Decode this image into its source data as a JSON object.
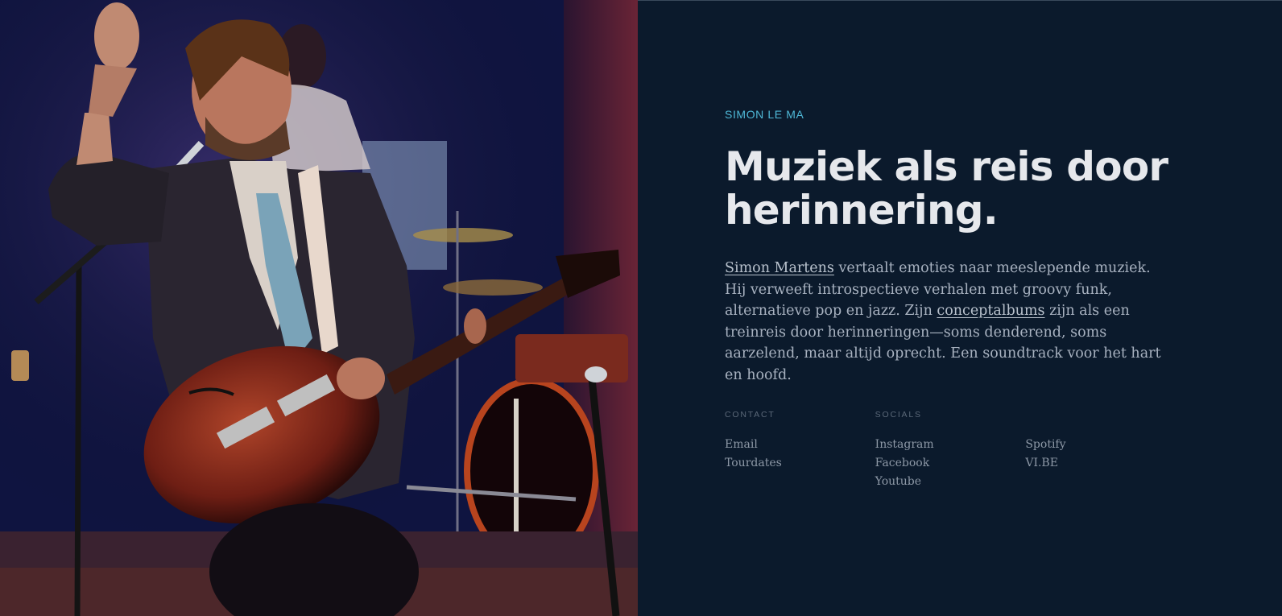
{
  "hero": {
    "image_alt": "Simon Martens speelt gitaar en zingt op een podium met drummer en bassist op de achtergrond"
  },
  "intro": {
    "eyebrow": "SIMON LE MA",
    "headline_line1": "Muziek als reis door",
    "headline_line2": "herinnering.",
    "bio": {
      "link_name": "Simon Martens",
      "part1": " vertaalt emoties naar meeslepende muziek. Hij verweeft introspectieve verhalen met groovy funk, alternatieve pop en jazz. Zijn ",
      "link_albums": "conceptalbums",
      "part2": " zijn als een treinreis door herinneringen—soms denderend, soms aarzelend, maar altijd oprecht. Een soundtrack voor het hart en hoofd."
    }
  },
  "links": {
    "contact": {
      "label": "CONTACT",
      "items": [
        "Email",
        "Tourdates"
      ]
    },
    "socials": {
      "label": "SOCIALS",
      "items": [
        "Instagram",
        "Facebook",
        "Youtube"
      ]
    },
    "socials_more": {
      "items": [
        "Spotify",
        "VI.BE"
      ]
    }
  },
  "colors": {
    "panel_bg": "#0b1a2c",
    "accent": "#4fb9d8",
    "headline": "#e6e8ec",
    "body_text": "#a8b2c0"
  }
}
